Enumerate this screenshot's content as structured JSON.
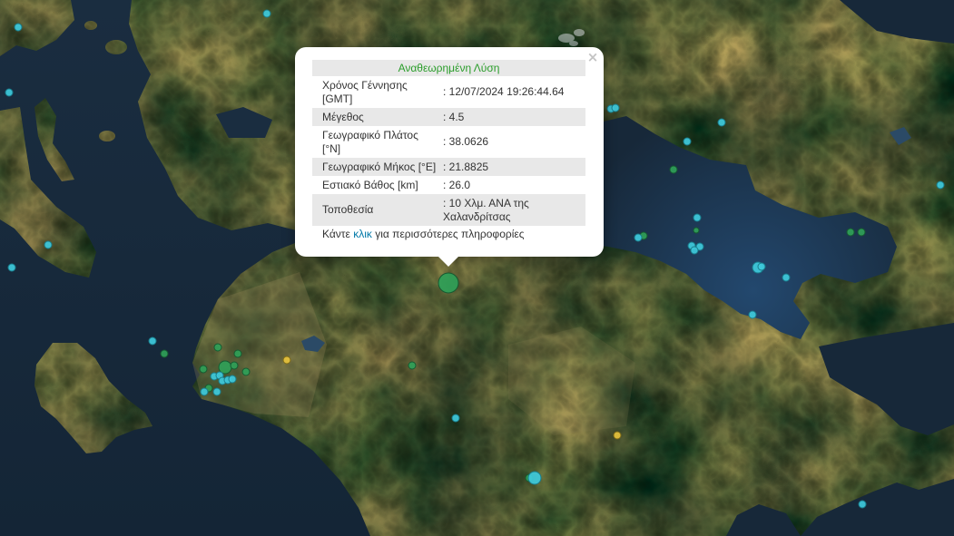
{
  "popup": {
    "close_label": "×",
    "title": "Αναθεωρημένη Λύση",
    "separator": ": ",
    "rows": [
      {
        "label": "Χρόνος Γέννησης [GMT]",
        "value": "12/07/2024 19:26:44.64"
      },
      {
        "label": "Μέγεθος",
        "value": "4.5"
      },
      {
        "label": "Γεωγραφικό Πλάτος [°N]",
        "value": "38.0626"
      },
      {
        "label": "Γεωγραφικό Μήκος [°E]",
        "value": "21.8825"
      },
      {
        "label": "Εστιακό Βάθος [km]",
        "value": "26.0"
      },
      {
        "label": "Τοποθεσία",
        "value": "10 Χλμ. ΑΝΑ της Χαλανδρίτσας"
      }
    ],
    "footer": {
      "before": "Κάντε ",
      "link": "κλικ",
      "after": " για περισσότερες πληροφορίες"
    }
  },
  "colors": {
    "marker_cyan": "#3ec9dc",
    "marker_green": "#2f9f57",
    "marker_yellow": "#e5c23c",
    "popup_title": "#2a9d2a",
    "link": "#0078a8",
    "row_stripe": "#e8e8e8",
    "sea": "#172839"
  }
}
